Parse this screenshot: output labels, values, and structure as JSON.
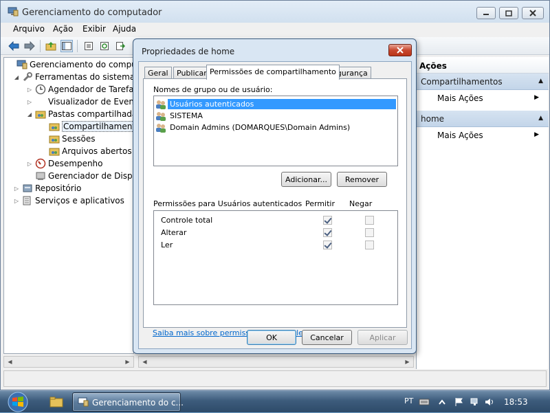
{
  "window": {
    "title": "Gerenciamento do computador"
  },
  "menu": [
    "Arquivo",
    "Ação",
    "Exibir",
    "Ajuda"
  ],
  "tree": {
    "items": [
      {
        "label": "Gerenciamento do computado",
        "icon": "computer-management-icon"
      },
      {
        "label": "Ferramentas do sistema",
        "icon": "tools-icon"
      },
      {
        "label": "Agendador de Tarefas",
        "icon": "clock-icon"
      },
      {
        "label": "Visualizador de Eventos",
        "icon": "event-viewer-icon"
      },
      {
        "label": "Pastas compartilhadas",
        "icon": "shared-folder-icon"
      },
      {
        "label": "Compartilhamentos",
        "icon": "shared-folder-icon"
      },
      {
        "label": "Sessões",
        "icon": "shared-folder-icon"
      },
      {
        "label": "Arquivos abertos",
        "icon": "shared-folder-icon"
      },
      {
        "label": "Desempenho",
        "icon": "performance-icon"
      },
      {
        "label": "Gerenciador de Disposi",
        "icon": "device-manager-icon"
      },
      {
        "label": "Repositório",
        "icon": "storage-icon"
      },
      {
        "label": "Serviços e aplicativos",
        "icon": "services-icon"
      }
    ]
  },
  "actions": {
    "header": "Ações",
    "sections": [
      {
        "title": "Compartilhamentos",
        "item": "Mais Ações"
      },
      {
        "title": "home",
        "item": "Mais Ações"
      }
    ]
  },
  "dialog": {
    "title": "Propriedades de home",
    "tabs": [
      "Geral",
      "Publicar",
      "Permissões de compartilhamento",
      "Segurança"
    ],
    "active_tab": "Permissões de compartilhamento",
    "groups_label": "Nomes de grupo ou de usuário:",
    "groups": [
      {
        "name": "Usuários autenticados",
        "selected": true
      },
      {
        "name": "SISTEMA",
        "selected": false
      },
      {
        "name": "Domain Admins (DOMARQUES\\Domain Admins)",
        "selected": false
      }
    ],
    "add_button": "Adicionar...",
    "remove_button": "Remover",
    "perms_label": "Permissões para Usuários autenticados",
    "allow_header": "Permitir",
    "deny_header": "Negar",
    "permissions": [
      {
        "name": "Controle total",
        "allow": true,
        "deny": false
      },
      {
        "name": "Alterar",
        "allow": true,
        "deny": false
      },
      {
        "name": "Ler",
        "allow": true,
        "deny": false
      }
    ],
    "help_link": "Saiba mais sobre permissões e controle de acesso",
    "ok_button": "OK",
    "cancel_button": "Cancelar",
    "apply_button": "Aplicar"
  },
  "taskbar": {
    "task_label": "Gerenciamento do c...",
    "language": "PT",
    "clock": "18:53"
  },
  "colors": {
    "selection": "#3399ff",
    "link": "#0066cc",
    "action_section": "#c3d5e9"
  }
}
